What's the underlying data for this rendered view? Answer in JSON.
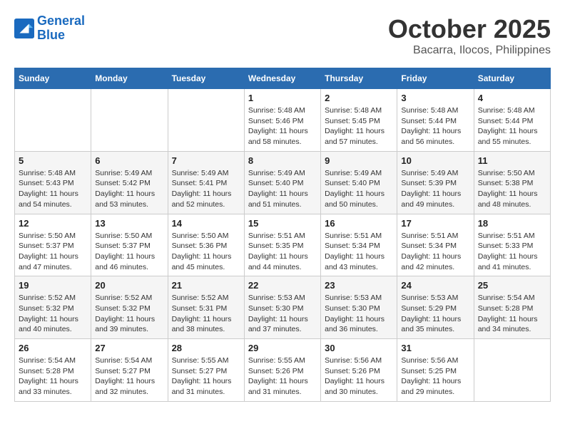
{
  "header": {
    "logo_line1": "General",
    "logo_line2": "Blue",
    "month": "October 2025",
    "location": "Bacarra, Ilocos, Philippines"
  },
  "days_of_week": [
    "Sunday",
    "Monday",
    "Tuesday",
    "Wednesday",
    "Thursday",
    "Friday",
    "Saturday"
  ],
  "weeks": [
    [
      {
        "day": "",
        "info": ""
      },
      {
        "day": "",
        "info": ""
      },
      {
        "day": "",
        "info": ""
      },
      {
        "day": "1",
        "info": "Sunrise: 5:48 AM\nSunset: 5:46 PM\nDaylight: 11 hours\nand 58 minutes."
      },
      {
        "day": "2",
        "info": "Sunrise: 5:48 AM\nSunset: 5:45 PM\nDaylight: 11 hours\nand 57 minutes."
      },
      {
        "day": "3",
        "info": "Sunrise: 5:48 AM\nSunset: 5:44 PM\nDaylight: 11 hours\nand 56 minutes."
      },
      {
        "day": "4",
        "info": "Sunrise: 5:48 AM\nSunset: 5:44 PM\nDaylight: 11 hours\nand 55 minutes."
      }
    ],
    [
      {
        "day": "5",
        "info": "Sunrise: 5:48 AM\nSunset: 5:43 PM\nDaylight: 11 hours\nand 54 minutes."
      },
      {
        "day": "6",
        "info": "Sunrise: 5:49 AM\nSunset: 5:42 PM\nDaylight: 11 hours\nand 53 minutes."
      },
      {
        "day": "7",
        "info": "Sunrise: 5:49 AM\nSunset: 5:41 PM\nDaylight: 11 hours\nand 52 minutes."
      },
      {
        "day": "8",
        "info": "Sunrise: 5:49 AM\nSunset: 5:40 PM\nDaylight: 11 hours\nand 51 minutes."
      },
      {
        "day": "9",
        "info": "Sunrise: 5:49 AM\nSunset: 5:40 PM\nDaylight: 11 hours\nand 50 minutes."
      },
      {
        "day": "10",
        "info": "Sunrise: 5:49 AM\nSunset: 5:39 PM\nDaylight: 11 hours\nand 49 minutes."
      },
      {
        "day": "11",
        "info": "Sunrise: 5:50 AM\nSunset: 5:38 PM\nDaylight: 11 hours\nand 48 minutes."
      }
    ],
    [
      {
        "day": "12",
        "info": "Sunrise: 5:50 AM\nSunset: 5:37 PM\nDaylight: 11 hours\nand 47 minutes."
      },
      {
        "day": "13",
        "info": "Sunrise: 5:50 AM\nSunset: 5:37 PM\nDaylight: 11 hours\nand 46 minutes."
      },
      {
        "day": "14",
        "info": "Sunrise: 5:50 AM\nSunset: 5:36 PM\nDaylight: 11 hours\nand 45 minutes."
      },
      {
        "day": "15",
        "info": "Sunrise: 5:51 AM\nSunset: 5:35 PM\nDaylight: 11 hours\nand 44 minutes."
      },
      {
        "day": "16",
        "info": "Sunrise: 5:51 AM\nSunset: 5:34 PM\nDaylight: 11 hours\nand 43 minutes."
      },
      {
        "day": "17",
        "info": "Sunrise: 5:51 AM\nSunset: 5:34 PM\nDaylight: 11 hours\nand 42 minutes."
      },
      {
        "day": "18",
        "info": "Sunrise: 5:51 AM\nSunset: 5:33 PM\nDaylight: 11 hours\nand 41 minutes."
      }
    ],
    [
      {
        "day": "19",
        "info": "Sunrise: 5:52 AM\nSunset: 5:32 PM\nDaylight: 11 hours\nand 40 minutes."
      },
      {
        "day": "20",
        "info": "Sunrise: 5:52 AM\nSunset: 5:32 PM\nDaylight: 11 hours\nand 39 minutes."
      },
      {
        "day": "21",
        "info": "Sunrise: 5:52 AM\nSunset: 5:31 PM\nDaylight: 11 hours\nand 38 minutes."
      },
      {
        "day": "22",
        "info": "Sunrise: 5:53 AM\nSunset: 5:30 PM\nDaylight: 11 hours\nand 37 minutes."
      },
      {
        "day": "23",
        "info": "Sunrise: 5:53 AM\nSunset: 5:30 PM\nDaylight: 11 hours\nand 36 minutes."
      },
      {
        "day": "24",
        "info": "Sunrise: 5:53 AM\nSunset: 5:29 PM\nDaylight: 11 hours\nand 35 minutes."
      },
      {
        "day": "25",
        "info": "Sunrise: 5:54 AM\nSunset: 5:28 PM\nDaylight: 11 hours\nand 34 minutes."
      }
    ],
    [
      {
        "day": "26",
        "info": "Sunrise: 5:54 AM\nSunset: 5:28 PM\nDaylight: 11 hours\nand 33 minutes."
      },
      {
        "day": "27",
        "info": "Sunrise: 5:54 AM\nSunset: 5:27 PM\nDaylight: 11 hours\nand 32 minutes."
      },
      {
        "day": "28",
        "info": "Sunrise: 5:55 AM\nSunset: 5:27 PM\nDaylight: 11 hours\nand 31 minutes."
      },
      {
        "day": "29",
        "info": "Sunrise: 5:55 AM\nSunset: 5:26 PM\nDaylight: 11 hours\nand 31 minutes."
      },
      {
        "day": "30",
        "info": "Sunrise: 5:56 AM\nSunset: 5:26 PM\nDaylight: 11 hours\nand 30 minutes."
      },
      {
        "day": "31",
        "info": "Sunrise: 5:56 AM\nSunset: 5:25 PM\nDaylight: 11 hours\nand 29 minutes."
      },
      {
        "day": "",
        "info": ""
      }
    ]
  ]
}
